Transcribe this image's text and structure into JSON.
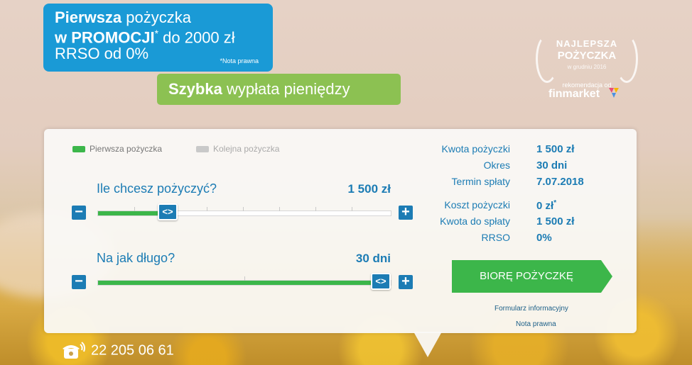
{
  "promo": {
    "line1_bold": "Pierwsza",
    "line1_rest": " pożyczka",
    "line2_bold": "w PROMOCJI",
    "line2_star": "*",
    "line2_rest": " do 2000 zł",
    "line3": "RRSO od 0%",
    "note": "*Nota prawna"
  },
  "speed": {
    "bold": "Szybka",
    "rest": " wypłata pieniędzy"
  },
  "award": {
    "line1": "NAJLEPSZA",
    "line2": "POŻYCZKA",
    "line3": "w grudniu 2016",
    "line4": "rekomendacja od",
    "brand": "finmarket"
  },
  "tabs": [
    {
      "label": "Pierwsza pożyczka",
      "active": true
    },
    {
      "label": "Kolejna pożyczka",
      "active": false
    }
  ],
  "amount_slider": {
    "label": "Ile chcesz pożyczyć?",
    "value": "1 500 zł",
    "position_fraction": 0.22
  },
  "term_slider": {
    "label": "Na jak długo?",
    "value": "30 dni",
    "position_fraction": 1.0
  },
  "summary": [
    {
      "key": "Kwota pożyczki",
      "value": "1 500 zł"
    },
    {
      "key": "Okres",
      "value": "30 dni"
    },
    {
      "key": "Termin spłaty",
      "value": "7.07.2018"
    },
    {
      "key": "Koszt pożyczki",
      "value": "0 zł",
      "star": "*"
    },
    {
      "key": "Kwota do spłaty",
      "value": "1 500 zł"
    },
    {
      "key": "RRSO",
      "value": "0%"
    }
  ],
  "cta_label": "BIORĘ POŻYCZKĘ",
  "links": {
    "form": "Formularz informacyjny",
    "legal": "Nota prawna"
  },
  "phone": "22 205 06 61",
  "colors": {
    "blue": "#1c7cb4",
    "promo_blue": "#1a9ad6",
    "green": "#3cb64a",
    "light_green": "#8cc152"
  }
}
